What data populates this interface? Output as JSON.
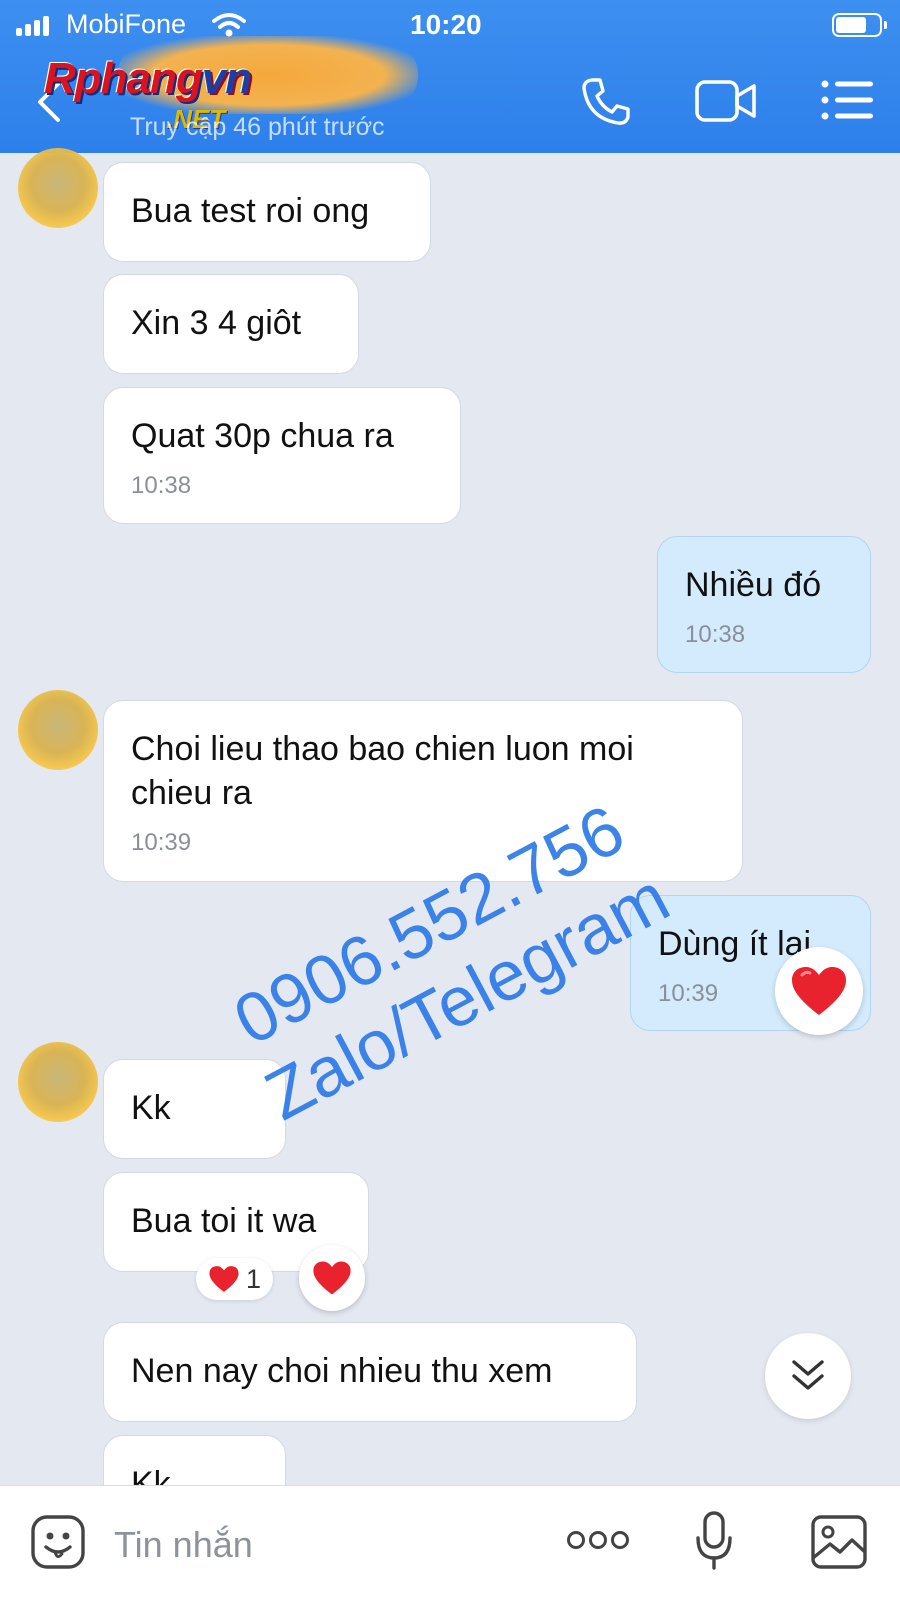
{
  "status_bar": {
    "carrier": "MobiFone",
    "time": "10:20"
  },
  "header": {
    "logo_main": "Rphang",
    "logo_accent": "vn",
    "logo_sub": ".NET",
    "subtitle": "Truy cập 46 phút trước",
    "icons": [
      "back-chevron-icon",
      "phone-icon",
      "video-call-icon",
      "menu-list-icon"
    ]
  },
  "messages": [
    {
      "id": "m1",
      "direction": "incoming",
      "text": "Bua test roi ong",
      "time": ""
    },
    {
      "id": "m2",
      "direction": "incoming",
      "text": "Xin 3 4 giôt",
      "time": ""
    },
    {
      "id": "m3",
      "direction": "incoming",
      "text": "Quat 30p chua ra",
      "time": "10:38"
    },
    {
      "id": "m4",
      "direction": "outgoing",
      "text": "Nhiều đó",
      "time": "10:38"
    },
    {
      "id": "m5",
      "direction": "incoming",
      "text": "Choi lieu thao bao chien luon moi chieu ra",
      "time": "10:39"
    },
    {
      "id": "m6",
      "direction": "outgoing",
      "text": "Dùng ít lại",
      "time": "10:39",
      "reaction": "heart"
    },
    {
      "id": "m7",
      "direction": "incoming",
      "text": "Kk",
      "time": ""
    },
    {
      "id": "m8",
      "direction": "incoming",
      "text": "Bua toi it wa",
      "time": "",
      "reaction_count": "1"
    },
    {
      "id": "m9",
      "direction": "incoming",
      "text": "Nen nay choi nhieu thu xem",
      "time": ""
    },
    {
      "id": "m10",
      "direction": "incoming",
      "text": "Kk",
      "time": ""
    }
  ],
  "watermark": {
    "line1": "0906.552.756",
    "line2": "Zalo/Telegram"
  },
  "composer": {
    "placeholder": "Tin nhắn",
    "icons": [
      "sticker-icon",
      "more-options-icon",
      "microphone-icon",
      "image-icon"
    ]
  },
  "colors": {
    "header_blue": "#3d8ff0",
    "outgoing_bubble": "#d4ebfd",
    "incoming_bubble": "#ffffff",
    "chat_background": "#e4e8f1",
    "heart": "#e8232e"
  }
}
